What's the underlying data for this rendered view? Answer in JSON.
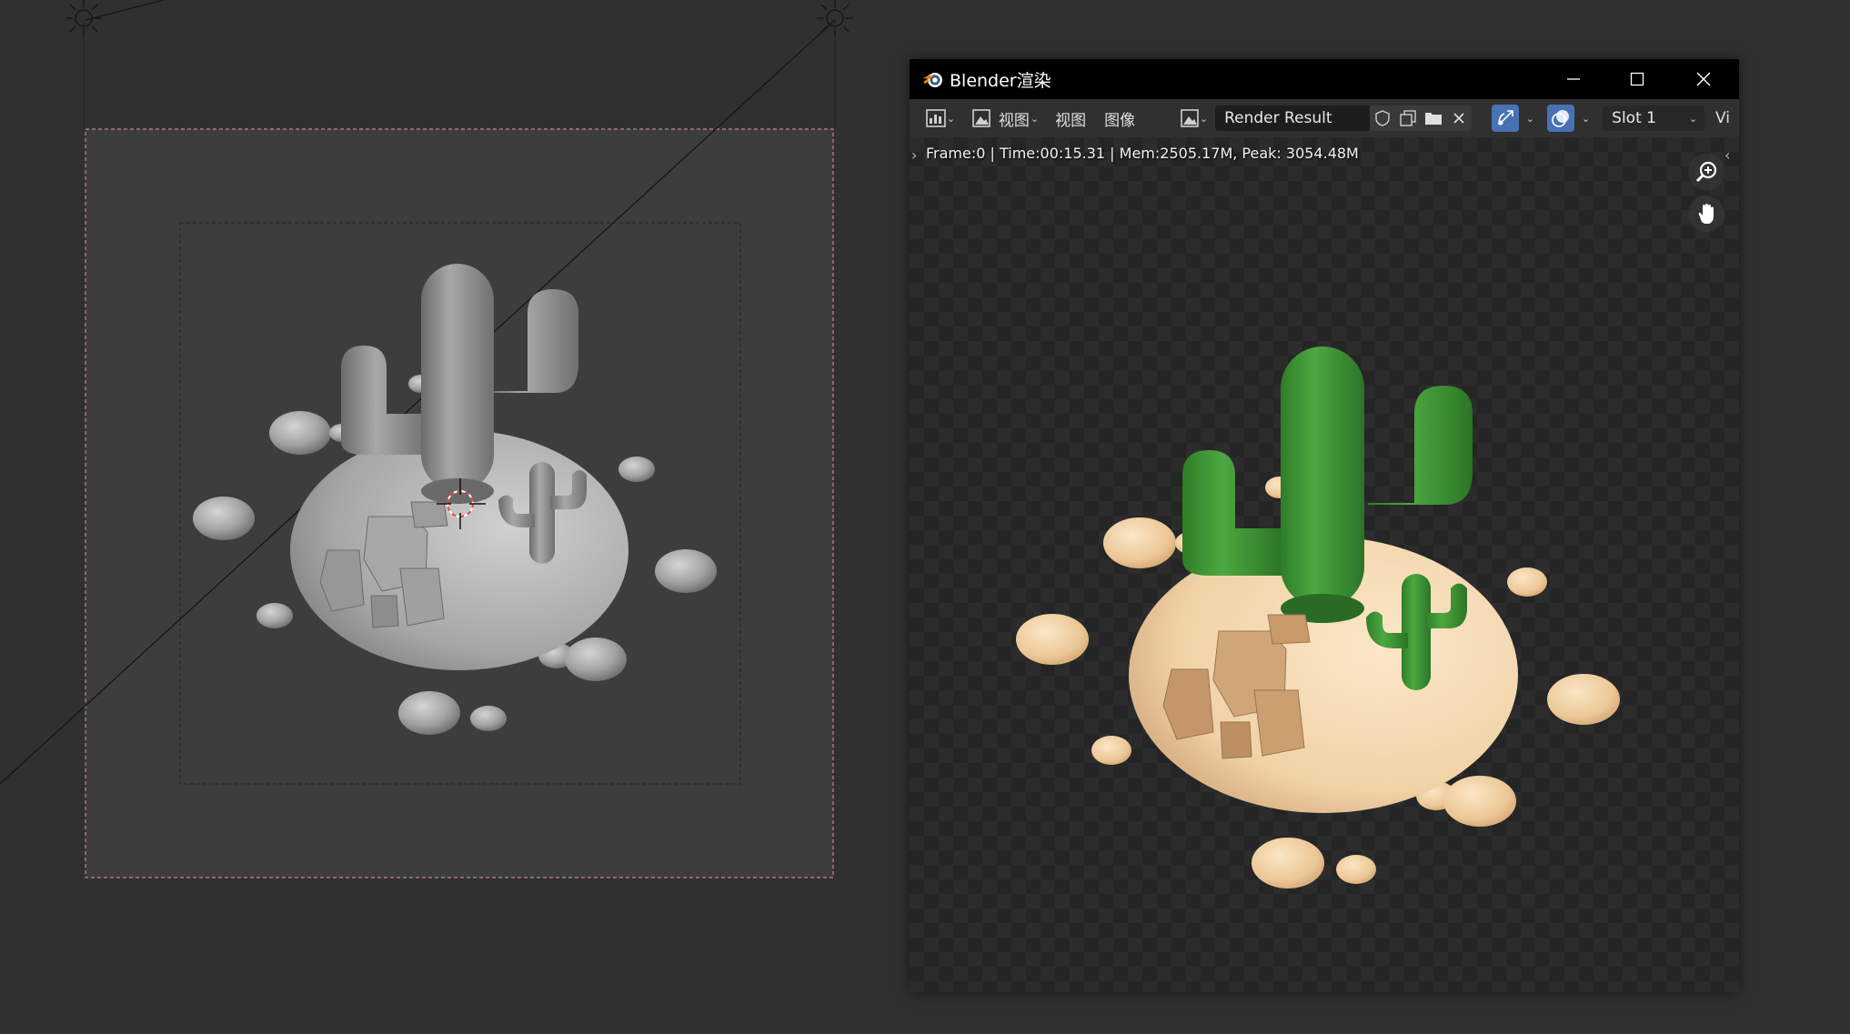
{
  "window": {
    "title": "Blender渲染",
    "minimize_icon": "minimize-icon",
    "maximize_icon": "maximize-icon",
    "close_icon": "close-icon"
  },
  "toolbar": {
    "editor_type_icon": "image-editor-icon",
    "mode_icon": "view-mode-icon",
    "view_menu_label": "视图",
    "view_menu2_label": "视图",
    "image_menu_label": "图像",
    "image_browse_icon": "image-browse-icon",
    "image_name": "Render Result",
    "fake_user_icon": "shield-icon",
    "duplicate_icon": "duplicate-icon",
    "open_icon": "folder-icon",
    "unlink_icon": "x-icon",
    "gizmo_icon": "gizmo-icon",
    "overlay_icon": "overlay-icon",
    "slot_label": "Slot 1",
    "view_label_cut": "Vi"
  },
  "stats": {
    "text": "Frame:0 | Time:00:15.31 | Mem:2505.17M, Peak: 3054.48M"
  },
  "navigation": {
    "zoom_icon": "zoom-in-icon",
    "pan_icon": "hand-icon"
  },
  "colors": {
    "cactus_green": "#3f9a35",
    "sand": "#f0d2a8",
    "rock": "#c99a6a",
    "viewport_gray": "#9a9a9a",
    "accent_blue": "#4772b3",
    "camera_frame": "#d08a8a"
  }
}
